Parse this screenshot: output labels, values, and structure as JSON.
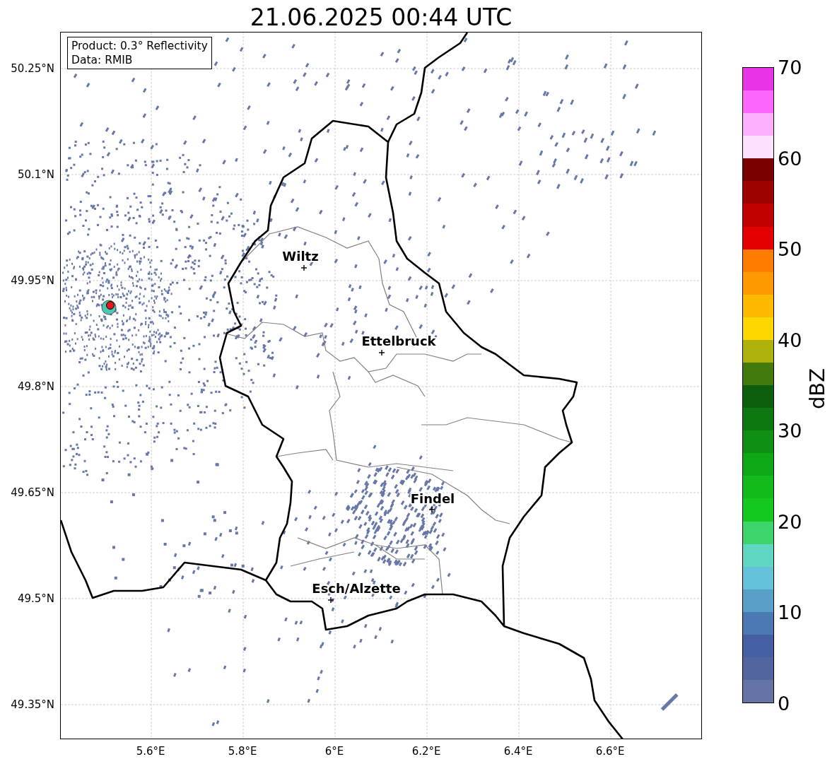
{
  "title": "21.06.2025 00:44 UTC",
  "info_box": {
    "lines": [
      "Product: 0.3° Reflectivity",
      "Data: RMIB"
    ]
  },
  "map": {
    "lat_ticks": [
      "50.25°N",
      "50.1°N",
      "49.95°N",
      "49.8°N",
      "49.65°N",
      "49.5°N",
      "49.35°N"
    ],
    "lon_ticks": [
      "5.6°E",
      "5.8°E",
      "6°E",
      "6.2°E",
      "6.4°E",
      "6.6°E"
    ],
    "cities": [
      {
        "name": "Wiltz"
      },
      {
        "name": "Ettelbruck"
      },
      {
        "name": "Findel"
      },
      {
        "name": "Esch/Alzette"
      }
    ]
  },
  "colorbar": {
    "label": "dBZ",
    "ticks": [
      "70",
      "60",
      "50",
      "40",
      "30",
      "20",
      "10",
      "0"
    ],
    "bins": [
      {
        "color": "#e634e6"
      },
      {
        "color": "#fc66fc"
      },
      {
        "color": "#fdb0fd"
      },
      {
        "color": "#fde0fc"
      },
      {
        "color": "#780000"
      },
      {
        "color": "#9f0000"
      },
      {
        "color": "#c10000"
      },
      {
        "color": "#e40000"
      },
      {
        "color": "#fe7c00"
      },
      {
        "color": "#fe9900"
      },
      {
        "color": "#fdb800"
      },
      {
        "color": "#fed700"
      },
      {
        "color": "#afb20a"
      },
      {
        "color": "#427a0c"
      },
      {
        "color": "#0b5e0b"
      },
      {
        "color": "#0e7810"
      },
      {
        "color": "#0f8f13"
      },
      {
        "color": "#10a717"
      },
      {
        "color": "#12bb1a"
      },
      {
        "color": "#13c81e"
      },
      {
        "color": "#3dd56b"
      },
      {
        "color": "#60d7c3"
      },
      {
        "color": "#64c3d8"
      },
      {
        "color": "#58a0c8"
      },
      {
        "color": "#4a79b3"
      },
      {
        "color": "#4460a2"
      },
      {
        "color": "#52659e"
      },
      {
        "color": "#6673a5"
      }
    ]
  }
}
